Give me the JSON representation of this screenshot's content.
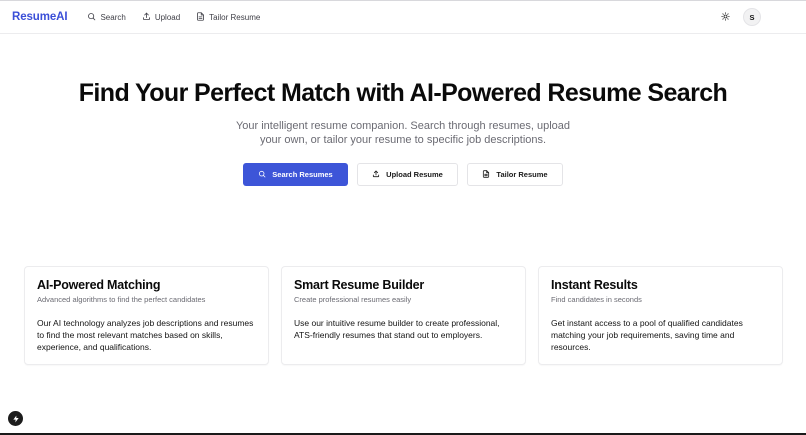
{
  "header": {
    "brand": "ResumeAI",
    "nav": [
      {
        "label": "Search",
        "icon": "search-icon"
      },
      {
        "label": "Upload",
        "icon": "upload-icon"
      },
      {
        "label": "Tailor Resume",
        "icon": "file-text-icon"
      }
    ],
    "theme_icon": "sun-icon",
    "avatar_initial": "S"
  },
  "hero": {
    "title": "Find Your Perfect Match with AI-Powered Resume Search",
    "subtitle": "Your intelligent resume companion. Search through resumes, upload your own, or tailor your resume to specific job descriptions.",
    "buttons": [
      {
        "label": "Search Resumes",
        "icon": "search-icon",
        "variant": "primary"
      },
      {
        "label": "Upload Resume",
        "icon": "upload-icon",
        "variant": "outline"
      },
      {
        "label": "Tailor Resume",
        "icon": "file-text-icon",
        "variant": "outline"
      }
    ]
  },
  "features": [
    {
      "title": "AI-Powered Matching",
      "description": "Advanced algorithms to find the perfect candidates",
      "body": "Our AI technology analyzes job descriptions and resumes to find the most relevant matches based on skills, experience, and qualifications."
    },
    {
      "title": "Smart Resume Builder",
      "description": "Create professional resumes easily",
      "body": "Use our intuitive resume builder to create professional, ATS-friendly resumes that stand out to employers."
    },
    {
      "title": "Instant Results",
      "description": "Find candidates in seconds",
      "body": "Get instant access to a pool of qualified candidates matching your job requirements, saving time and resources."
    }
  ],
  "colors": {
    "brand": "#3b4fd8",
    "primary_button": "#3d55d8",
    "muted_text": "#6b6b73",
    "border": "#e4e4e7"
  },
  "fab_icon": "lightning-icon"
}
